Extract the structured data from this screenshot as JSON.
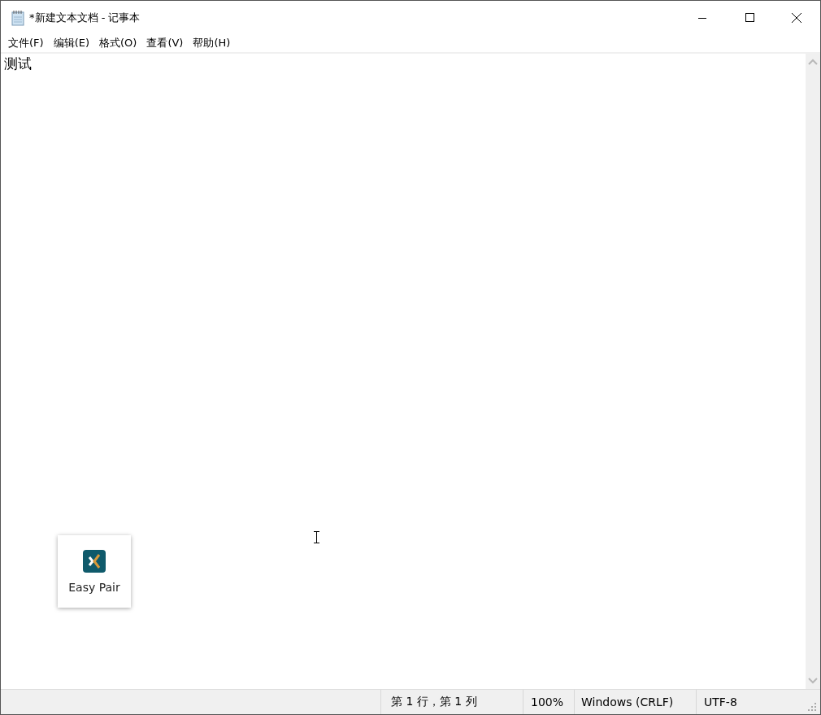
{
  "window": {
    "title": "*新建文本文档 - 记事本"
  },
  "menu": [
    "文件(F)",
    "编辑(E)",
    "格式(O)",
    "查看(V)",
    "帮助(H)"
  ],
  "editor": {
    "value": "测试"
  },
  "popup": {
    "label": "Easy Pair"
  },
  "status_bar": [
    "第 1 行，第 1 列",
    "100%",
    "Windows (CRLF)",
    "UTF-8"
  ]
}
